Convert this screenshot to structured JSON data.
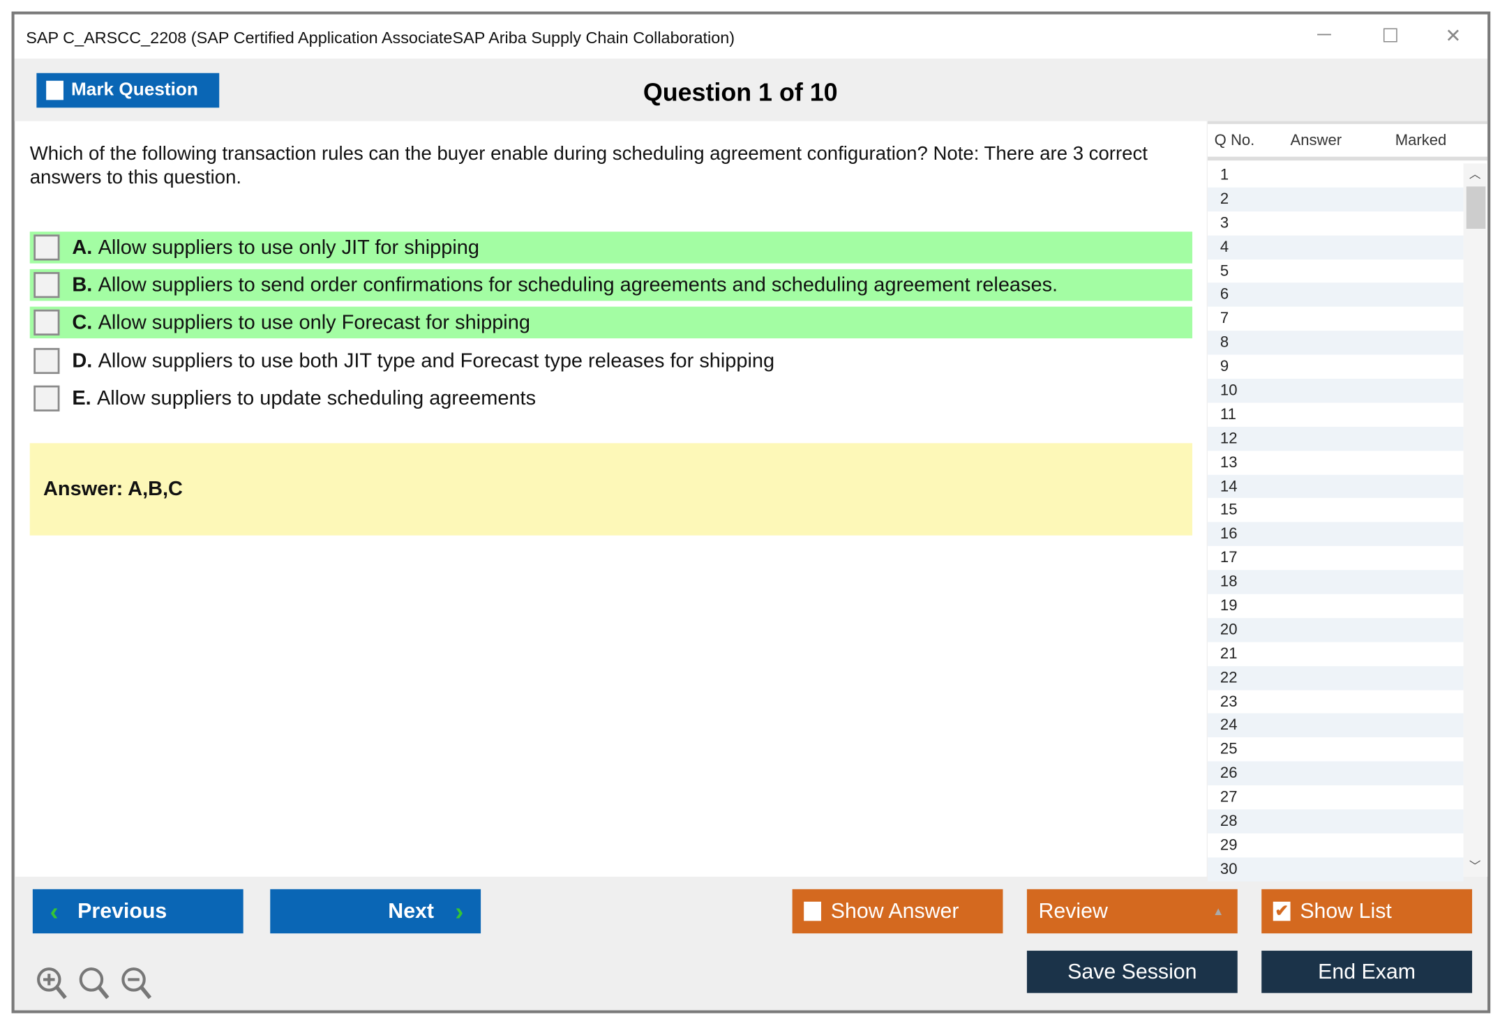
{
  "window": {
    "title": "SAP C_ARSCC_2208 (SAP Certified Application AssociateSAP Ariba Supply Chain Collaboration)",
    "minimize": "─",
    "maximize": "☐",
    "close": "✕"
  },
  "header": {
    "mark_label": "Mark Question",
    "question_title": "Question 1 of 10"
  },
  "question": {
    "text": "Which of the following transaction rules can the buyer enable during scheduling agreement configuration? Note: There are 3 correct answers to this question.",
    "options": [
      {
        "letter": "A.",
        "text": "Allow suppliers to use only JIT for shipping",
        "highlighted": true
      },
      {
        "letter": "B.",
        "text": "Allow suppliers to send order confirmations for scheduling agreements and scheduling agreement releases.",
        "highlighted": true
      },
      {
        "letter": "C.",
        "text": "Allow suppliers to use only Forecast for shipping",
        "highlighted": true
      },
      {
        "letter": "D.",
        "text": "Allow suppliers to use both JIT type and Forecast type releases for shipping",
        "highlighted": false
      },
      {
        "letter": "E.",
        "text": "Allow suppliers to update scheduling agreements",
        "highlighted": false
      }
    ]
  },
  "answer": "Answer: A,B,C",
  "panel": {
    "headers": [
      "Q No.",
      "Answer",
      "Marked"
    ],
    "rows": [
      "1",
      "2",
      "3",
      "4",
      "5",
      "6",
      "7",
      "8",
      "9",
      "10",
      "11",
      "12",
      "13",
      "14",
      "15",
      "16",
      "17",
      "18",
      "19",
      "20",
      "21",
      "22",
      "23",
      "24",
      "25",
      "26",
      "27",
      "28",
      "29",
      "30"
    ]
  },
  "footer": {
    "previous": "Previous",
    "next": "Next",
    "show_answer": "Show Answer",
    "review": "Review",
    "show_list": "Show List",
    "save_session": "Save Session",
    "end_exam": "End Exam"
  },
  "colors": {
    "blue": "#0a66b5",
    "orange": "#d4691f",
    "dark": "#1b3349",
    "correct": "#a3fda3",
    "answer_bg": "#fdf8b8"
  }
}
